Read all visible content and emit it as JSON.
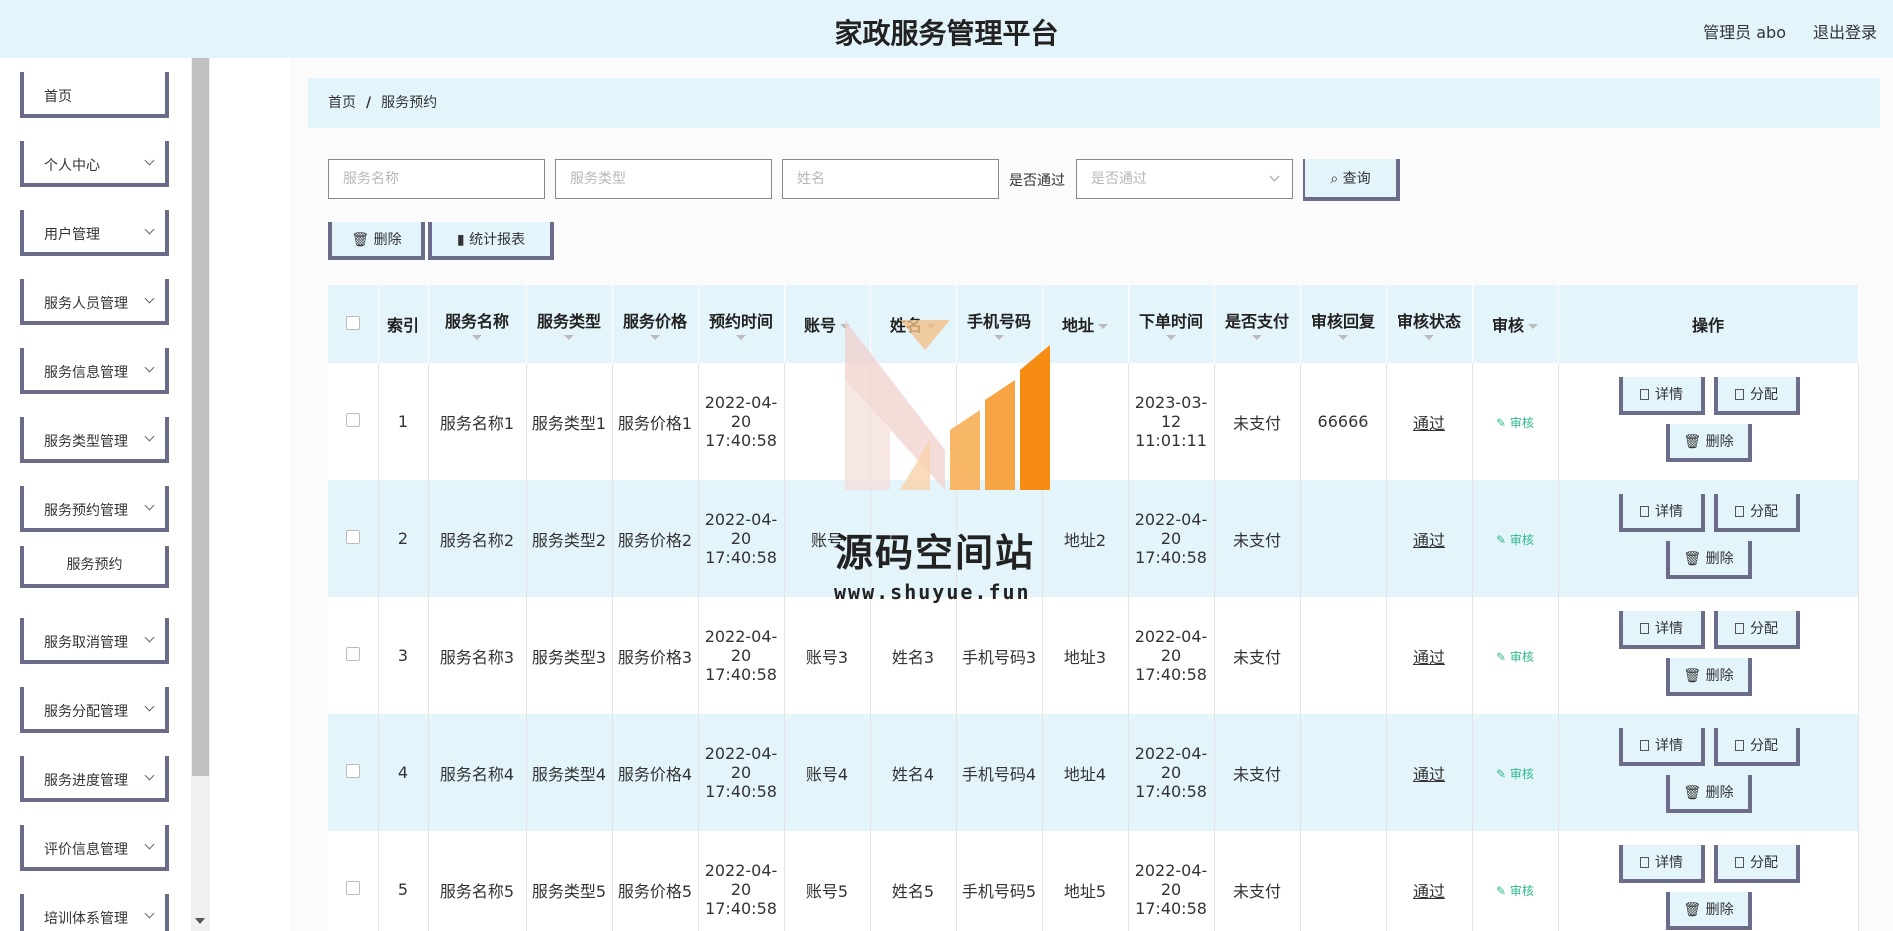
{
  "header": {
    "title": "家政服务管理平台",
    "admin": "管理员 abo",
    "logout": "退出登录"
  },
  "sidebar": {
    "items": [
      {
        "label": "首页"
      },
      {
        "label": "个人中心"
      },
      {
        "label": "用户管理"
      },
      {
        "label": "服务人员管理"
      },
      {
        "label": "服务信息管理"
      },
      {
        "label": "服务类型管理"
      },
      {
        "label": "服务预约管理"
      },
      {
        "label": "服务预约"
      },
      {
        "label": "服务取消管理"
      },
      {
        "label": "服务分配管理"
      },
      {
        "label": "服务进度管理"
      },
      {
        "label": "评价信息管理"
      },
      {
        "label": "培训体系管理"
      }
    ]
  },
  "breadcrumb": {
    "home": "首页",
    "sep": "/",
    "current": "服务预约"
  },
  "filter": {
    "service_name_placeholder": "服务名称",
    "service_type_placeholder": "服务类型",
    "name_placeholder": "姓名",
    "pass_label": "是否通过",
    "pass_placeholder": "是否通过",
    "query": "查询"
  },
  "toolbar": {
    "delete": "删除",
    "report": "统计报表"
  },
  "table": {
    "columns": [
      "索引",
      "服务名称",
      "服务类型",
      "服务价格",
      "预约时间",
      "账号",
      "姓名",
      "手机号码",
      "地址",
      "下单时间",
      "是否支付",
      "审核回复",
      "审核状态",
      "审核",
      "操作"
    ],
    "rows": [
      {
        "index": "1",
        "service_name": "服务名称1",
        "service_type": "服务类型1",
        "price": "服务价格1",
        "booking_time": "2022-04-20 17:40:58",
        "account": "",
        "name": "",
        "phone": "",
        "address": "",
        "order_time": "2023-03-12 11:01:11",
        "paid": "未支付",
        "reply": "66666",
        "status": "通过",
        "audit": "审核"
      },
      {
        "index": "2",
        "service_name": "服务名称2",
        "service_type": "服务类型2",
        "price": "服务价格2",
        "booking_time": "2022-04-20 17:40:58",
        "account": "账号",
        "name": "",
        "phone": "",
        "address": "地址2",
        "order_time": "2022-04-20 17:40:58",
        "paid": "未支付",
        "reply": "",
        "status": "通过",
        "audit": "审核"
      },
      {
        "index": "3",
        "service_name": "服务名称3",
        "service_type": "服务类型3",
        "price": "服务价格3",
        "booking_time": "2022-04-20 17:40:58",
        "account": "账号3",
        "name": "姓名3",
        "phone": "手机号码3",
        "address": "地址3",
        "order_time": "2022-04-20 17:40:58",
        "paid": "未支付",
        "reply": "",
        "status": "通过",
        "audit": "审核"
      },
      {
        "index": "4",
        "service_name": "服务名称4",
        "service_type": "服务类型4",
        "price": "服务价格4",
        "booking_time": "2022-04-20 17:40:58",
        "account": "账号4",
        "name": "姓名4",
        "phone": "手机号码4",
        "address": "地址4",
        "order_time": "2022-04-20 17:40:58",
        "paid": "未支付",
        "reply": "",
        "status": "通过",
        "audit": "审核"
      },
      {
        "index": "5",
        "service_name": "服务名称5",
        "service_type": "服务类型5",
        "price": "服务价格5",
        "booking_time": "2022-04-20 17:40:58",
        "account": "账号5",
        "name": "姓名5",
        "phone": "手机号码5",
        "address": "地址5",
        "order_time": "2022-04-20 17:40:58",
        "paid": "未支付",
        "reply": "",
        "status": "通过",
        "audit": "审核"
      }
    ],
    "ops": {
      "detail": "详情",
      "assign": "分配",
      "delete": "删除"
    }
  },
  "watermark": {
    "text": "源码空间站",
    "url": "www.shuyue.fun"
  },
  "colors": {
    "accent": "#e3f4fb",
    "border": "#6b6b8a",
    "audit": "#2fb98d"
  }
}
